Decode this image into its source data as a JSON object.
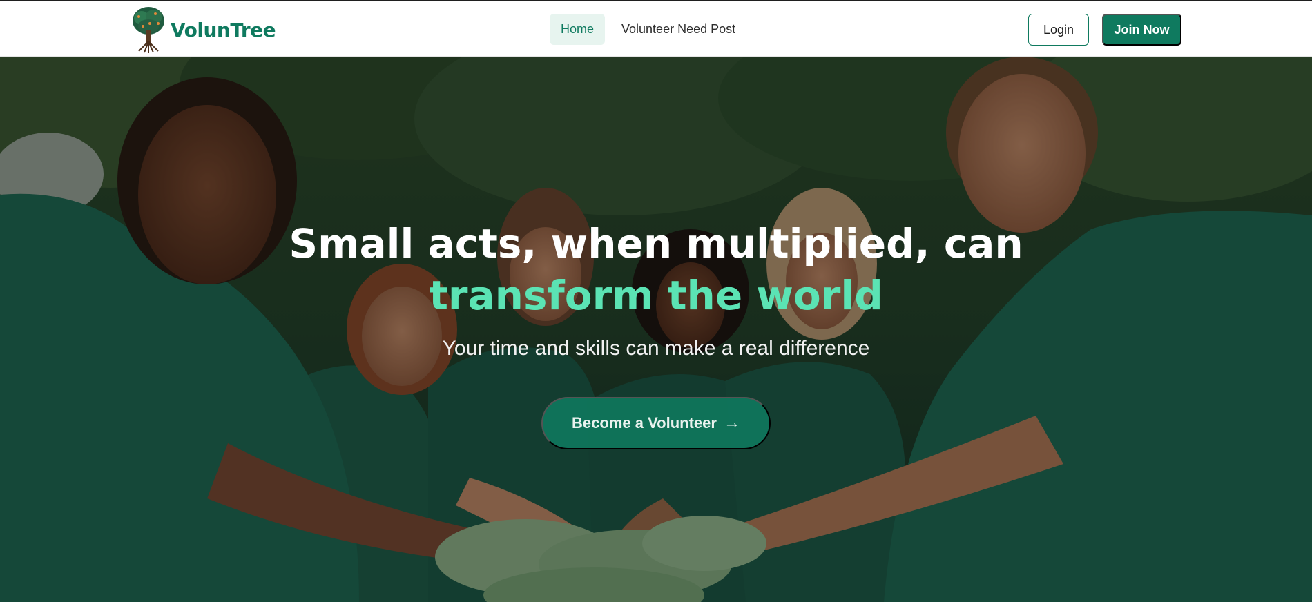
{
  "brand": {
    "name": "VolunTree"
  },
  "nav": {
    "items": [
      {
        "label": "Home",
        "active": true
      },
      {
        "label": "Volunteer Need Post",
        "active": false
      }
    ]
  },
  "auth": {
    "login_label": "Login",
    "join_label": "Join Now"
  },
  "hero": {
    "title_main": "Small acts, when multiplied, can ",
    "title_accent": "transform the world",
    "subtitle": "Your time and skills can make a real difference",
    "cta_label": "Become a Volunteer",
    "cta_icon": "arrow-right-icon"
  },
  "colors": {
    "brand_green": "#0f7a5f",
    "accent_mint": "#5be3b4",
    "active_nav_bg": "#e7f4ef"
  }
}
